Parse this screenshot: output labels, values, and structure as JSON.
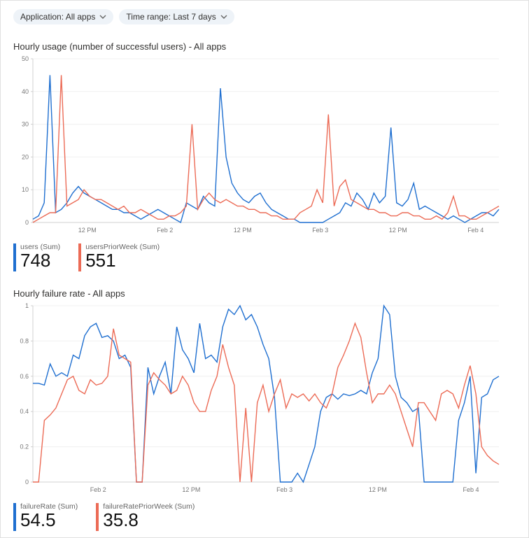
{
  "filters": {
    "application": {
      "label": "Application: All apps"
    },
    "timerange": {
      "label": "Time range: Last 7 days"
    }
  },
  "colors": {
    "seriesA": "#1f6fd0",
    "seriesB": "#ec6b56"
  },
  "chart1": {
    "title": "Hourly usage (number of successful users) - All apps",
    "legend": [
      {
        "label": "users (Sum)",
        "value": "748"
      },
      {
        "label": "usersPriorWeek (Sum)",
        "value": "551"
      }
    ]
  },
  "chart2": {
    "title": "Hourly failure rate - All apps",
    "legend": [
      {
        "label": "failureRate (Sum)",
        "value": "54.5"
      },
      {
        "label": "failureRatePriorWeek (Sum)",
        "value": "35.8"
      }
    ]
  },
  "chart_data": [
    {
      "type": "line",
      "title": "Hourly usage (number of successful users) - All apps",
      "xlabel": "",
      "ylabel": "",
      "ylim": [
        0,
        50
      ],
      "y_ticks": [
        0,
        10,
        20,
        30,
        40,
        50
      ],
      "x_tick_labels": [
        "12 PM",
        "Feb 2",
        "12 PM",
        "Feb 3",
        "12 PM",
        "Feb 4"
      ],
      "series": [
        {
          "name": "users (Sum)",
          "color": "#1f6fd0",
          "values": [
            1,
            2,
            6,
            45,
            3,
            4,
            6,
            9,
            11,
            9,
            8,
            7,
            6,
            5,
            4,
            4,
            3,
            3,
            2,
            1,
            2,
            3,
            4,
            3,
            2,
            1,
            0,
            6,
            5,
            4,
            8,
            6,
            5,
            41,
            20,
            12,
            9,
            7,
            6,
            8,
            9,
            6,
            4,
            3,
            2,
            1,
            1,
            0,
            0,
            0,
            0,
            0,
            1,
            2,
            3,
            6,
            5,
            9,
            7,
            4,
            9,
            6,
            8,
            29,
            6,
            5,
            7,
            12,
            4,
            5,
            4,
            3,
            2,
            1,
            2,
            1,
            0,
            1,
            2,
            3,
            3,
            2,
            4
          ]
        },
        {
          "name": "usersPriorWeek (Sum)",
          "color": "#ec6b56",
          "values": [
            0,
            1,
            2,
            3,
            3,
            45,
            5,
            6,
            7,
            10,
            8,
            7,
            7,
            6,
            5,
            4,
            5,
            3,
            3,
            4,
            3,
            2,
            1,
            1,
            2,
            2,
            3,
            5,
            30,
            4,
            7,
            9,
            7,
            6,
            7,
            6,
            5,
            5,
            4,
            4,
            3,
            3,
            2,
            2,
            1,
            1,
            1,
            3,
            4,
            5,
            10,
            6,
            33,
            5,
            11,
            13,
            7,
            6,
            5,
            4,
            4,
            3,
            3,
            2,
            2,
            3,
            3,
            2,
            2,
            1,
            1,
            2,
            1,
            3,
            8,
            2,
            2,
            1,
            1,
            2,
            3,
            4,
            5
          ]
        }
      ]
    },
    {
      "type": "line",
      "title": "Hourly failure rate - All apps",
      "xlabel": "",
      "ylabel": "",
      "ylim": [
        0,
        1
      ],
      "y_ticks": [
        0,
        0.2,
        0.4,
        0.6,
        0.8,
        1
      ],
      "x_tick_labels": [
        "Feb 2",
        "12 PM",
        "Feb 3",
        "12 PM",
        "Feb 4"
      ],
      "series": [
        {
          "name": "failureRate (Sum)",
          "color": "#1f6fd0",
          "values": [
            0.56,
            0.56,
            0.55,
            0.67,
            0.6,
            0.62,
            0.6,
            0.72,
            0.7,
            0.83,
            0.88,
            0.9,
            0.82,
            0.83,
            0.8,
            0.7,
            0.72,
            0.65,
            0.0,
            0.0,
            0.65,
            0.5,
            0.6,
            0.68,
            0.5,
            0.88,
            0.75,
            0.7,
            0.62,
            0.9,
            0.7,
            0.72,
            0.68,
            0.88,
            0.98,
            0.95,
            1.0,
            0.92,
            0.95,
            0.88,
            0.78,
            0.7,
            0.48,
            0.0,
            0.0,
            0.0,
            0.05,
            0.0,
            0.1,
            0.2,
            0.4,
            0.48,
            0.5,
            0.47,
            0.5,
            0.49,
            0.5,
            0.52,
            0.5,
            0.62,
            0.7,
            1.0,
            0.95,
            0.6,
            0.48,
            0.45,
            0.4,
            0.42,
            0.0,
            0.0,
            0.0,
            0.0,
            0.0,
            0.0,
            0.35,
            0.45,
            0.6,
            0.05,
            0.48,
            0.5,
            0.58,
            0.6
          ]
        },
        {
          "name": "failureRatePriorWeek (Sum)",
          "color": "#ec6b56",
          "values": [
            0.0,
            0.0,
            0.35,
            0.38,
            0.42,
            0.5,
            0.58,
            0.6,
            0.52,
            0.5,
            0.58,
            0.55,
            0.56,
            0.6,
            0.87,
            0.72,
            0.7,
            0.68,
            0.0,
            0.0,
            0.55,
            0.62,
            0.58,
            0.55,
            0.5,
            0.52,
            0.6,
            0.55,
            0.45,
            0.4,
            0.4,
            0.52,
            0.6,
            0.78,
            0.65,
            0.55,
            0.0,
            0.42,
            0.0,
            0.45,
            0.55,
            0.4,
            0.5,
            0.58,
            0.42,
            0.5,
            0.48,
            0.5,
            0.46,
            0.5,
            0.45,
            0.42,
            0.5,
            0.65,
            0.72,
            0.8,
            0.9,
            0.82,
            0.62,
            0.45,
            0.5,
            0.5,
            0.55,
            0.5,
            0.4,
            0.3,
            0.2,
            0.45,
            0.45,
            0.4,
            0.35,
            0.5,
            0.52,
            0.5,
            0.42,
            0.55,
            0.66,
            0.5,
            0.2,
            0.15,
            0.12,
            0.1
          ]
        }
      ]
    }
  ]
}
